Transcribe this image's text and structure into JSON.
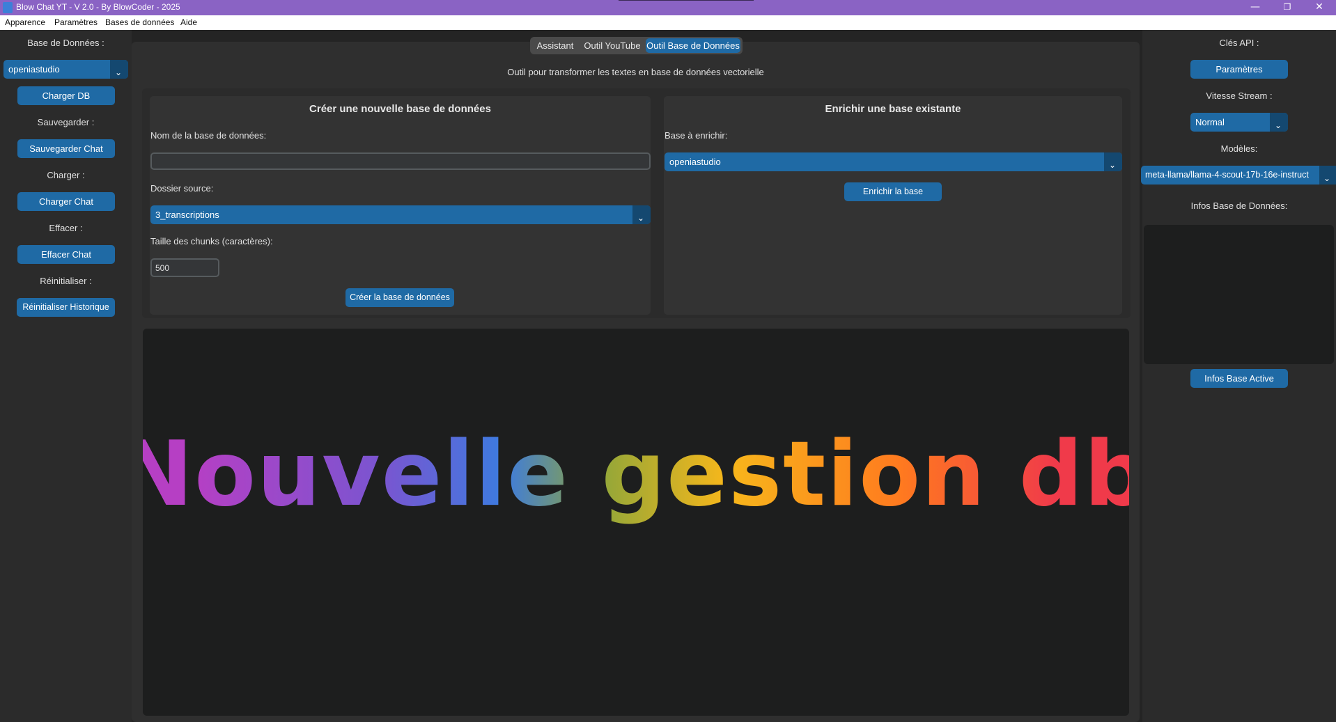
{
  "window": {
    "title": "Blow Chat YT - V 2.0 - By BlowCoder - 2025",
    "controls": {
      "minimize": "—",
      "maximize": "❐",
      "close": "✕"
    }
  },
  "menubar": [
    "Apparence",
    "Paramètres",
    "Bases de données",
    "Aide"
  ],
  "left_sidebar": {
    "db_label": "Base de Données :",
    "db_selected": "openiastudio",
    "load_db_button": "Charger DB",
    "save_label": "Sauvegarder :",
    "save_chat_button": "Sauvegarder Chat",
    "load_label": "Charger :",
    "load_chat_button": "Charger Chat",
    "clear_label": "Effacer :",
    "clear_chat_button": "Effacer Chat",
    "reset_label": "Réinitialiser :",
    "reset_history_button": "Réinitialiser Historique"
  },
  "tabs": [
    "Assistant",
    "Outil YouTube",
    "Outil Base de Données"
  ],
  "active_tab": "Outil Base de Données",
  "tool_description": "Outil pour transformer les textes en base de données vectorielle",
  "create_panel": {
    "title": "Créer une nouvelle base de données",
    "name_label": "Nom de la base de données:",
    "name_value": "",
    "source_label": "Dossier source:",
    "source_selected": "3_transcriptions",
    "chunk_label": "Taille des chunks (caractères):",
    "chunk_value": "500",
    "create_button": "Créer la base de données"
  },
  "enrich_panel": {
    "title": "Enrichir une base existante",
    "base_label": "Base à enrichir:",
    "base_selected": "openiastudio",
    "enrich_button": "Enrichir la base"
  },
  "banner": {
    "text": "Nouvelle gestion db",
    "gradient_colors": [
      "#b63fc4",
      "#7a55d0",
      "#3d7be0",
      "#8fa63a",
      "#f7b71b",
      "#ff7a1f",
      "#f03a4a"
    ]
  },
  "right_sidebar": {
    "api_label": "Clés API :",
    "settings_button": "Paramètres",
    "stream_label": "Vitesse Stream :",
    "stream_selected": "Normal",
    "models_label": "Modèles:",
    "model_selected": "meta-llama/llama-4-scout-17b-16e-instruct",
    "infos_label": "Infos Base de Données:",
    "infos_button": "Infos Base Active"
  },
  "colors": {
    "titlebar": "#8a63c4",
    "accent": "#1f6aa5",
    "accent_dark": "#144870",
    "background": "#242424"
  }
}
